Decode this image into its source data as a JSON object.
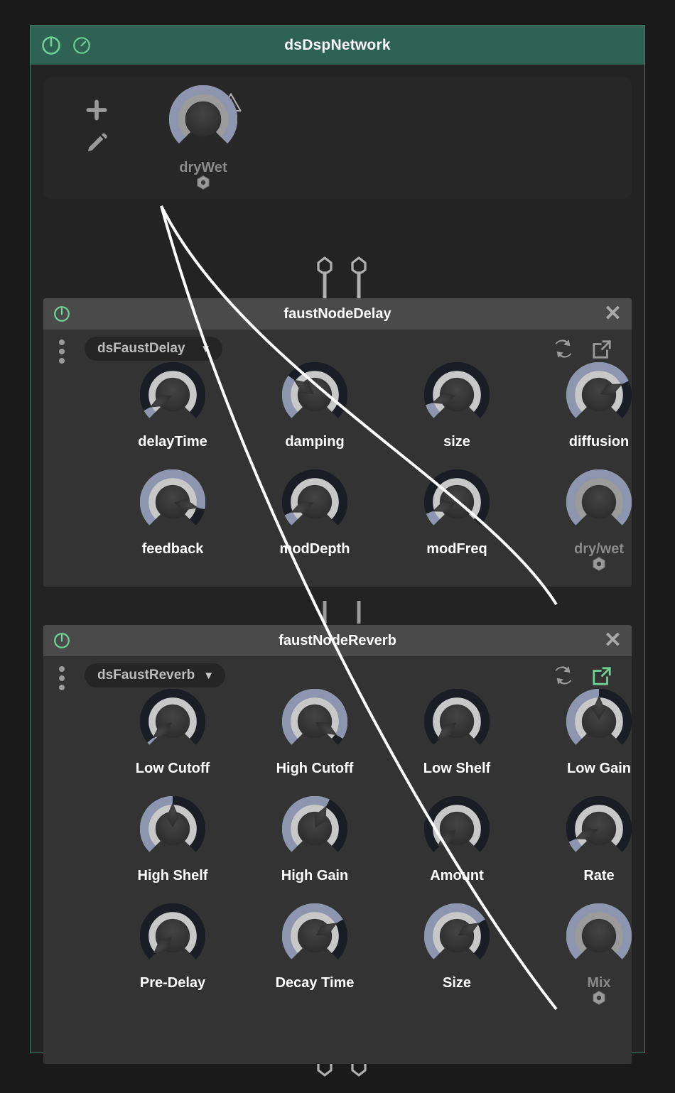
{
  "window": {
    "title": "dsDspNetwork",
    "accent_green": "#6fcf97",
    "titlebar_bg": "#2e6353",
    "power_icon": "power-icon",
    "bypass_icon": "bypass-circle-icon"
  },
  "toolbar": {
    "add_icon": "plus-icon",
    "edit_icon": "pencil-icon",
    "warning_icon": "warning-triangle-icon"
  },
  "network_params": [
    {
      "label": "dryWet",
      "value": 0.82,
      "style": "large",
      "modulated": true,
      "has_port": true
    }
  ],
  "nodes": [
    {
      "id": "delay",
      "title": "faustNodeDelay",
      "power_icon": "power-icon",
      "close_icon": "close-x-icon",
      "menu_icon": "three-dots-vertical-icon",
      "dropdown": {
        "value": "dsFaustDelay",
        "caret": "chevron-down-icon"
      },
      "swap_icon": "swap-arrows-icon",
      "open_icon": "open-external-icon",
      "open_icon_active": false,
      "knobs": [
        {
          "label": "delayTime",
          "value": 0.06,
          "modulated": false
        },
        {
          "label": "damping",
          "value": 0.3,
          "modulated": false
        },
        {
          "label": "size",
          "value": 0.1,
          "modulated": false
        },
        {
          "label": "diffusion",
          "value": 0.74,
          "modulated": false
        },
        {
          "label": "feedback",
          "value": 0.88,
          "modulated": false
        },
        {
          "label": "modDepth",
          "value": 0.08,
          "modulated": false
        },
        {
          "label": "modFreq",
          "value": 0.09,
          "modulated": false
        },
        {
          "label": "dry/wet",
          "value": 1.0,
          "modulated": true,
          "has_port": true
        }
      ]
    },
    {
      "id": "reverb",
      "title": "faustNodeReverb",
      "power_icon": "power-icon",
      "close_icon": "close-x-icon",
      "menu_icon": "three-dots-vertical-icon",
      "dropdown": {
        "value": "dsFaustReverb",
        "caret": "chevron-down-icon"
      },
      "swap_icon": "swap-arrows-icon",
      "open_icon": "open-external-icon",
      "open_icon_active": true,
      "knobs": [
        {
          "label": "Low Cutoff",
          "value": 0.02,
          "modulated": false
        },
        {
          "label": "High Cutoff",
          "value": 0.95,
          "modulated": false
        },
        {
          "label": "Low Shelf",
          "value": 0.01,
          "modulated": false
        },
        {
          "label": "Low Gain",
          "value": 0.5,
          "modulated": false
        },
        {
          "label": "High Shelf",
          "value": 0.5,
          "modulated": false
        },
        {
          "label": "High Gain",
          "value": 0.6,
          "modulated": false
        },
        {
          "label": "Amount",
          "value": 0.01,
          "modulated": false
        },
        {
          "label": "Rate",
          "value": 0.08,
          "modulated": false
        },
        {
          "label": "Pre-Delay",
          "value": 0.01,
          "modulated": false
        },
        {
          "label": "Decay Time",
          "value": 0.72,
          "modulated": false
        },
        {
          "label": "Size",
          "value": 0.72,
          "modulated": false
        },
        {
          "label": "Mix",
          "value": 1.0,
          "modulated": true,
          "has_port": true
        }
      ]
    }
  ],
  "io_connectors": {
    "top_in": {
      "icon": "audio-input-arrow-up-icon",
      "count": 2
    },
    "mid": {
      "icon": "audio-link-icon",
      "count": 2
    },
    "bottom_out": {
      "icon": "audio-output-arrow-down-icon",
      "count": 2
    }
  },
  "colors": {
    "knob_track": "#1b1d24",
    "knob_ring": "#c8c8c8",
    "knob_arc": "#8d96ae",
    "knob_center_top": "#444444",
    "knob_center_bottom": "#2a2a2a",
    "cable": "#ffffff",
    "panel_bg": "#333333",
    "node_header": "#4a4a4a",
    "label": "#ffffff",
    "label_dim": "#8a8a8a"
  }
}
